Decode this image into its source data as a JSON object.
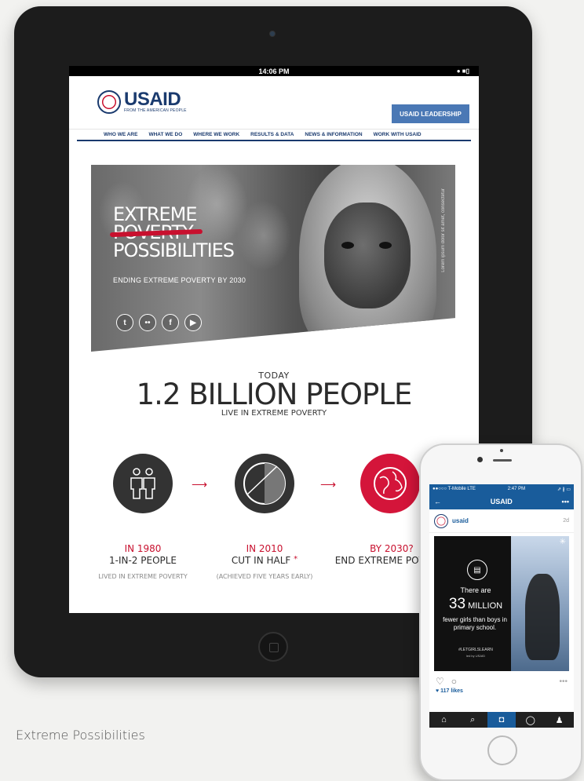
{
  "tablet": {
    "status_time": "14:06 PM",
    "status_right": "● ■▯"
  },
  "site": {
    "logo_word": "USAID",
    "logo_tagline": "FROM THE AMERICAN PEOPLE",
    "leadership_button": "USAID LEADERSHIP",
    "nav": [
      "WHO WE ARE",
      "WHAT WE DO",
      "WHERE WE WORK",
      "RESULTS & DATA",
      "NEWS & INFORMATION",
      "WORK WITH USAID"
    ]
  },
  "hero": {
    "title_line1": "EXTREME",
    "title_line2": "POVERTY",
    "title_line3": "POSSIBILITIES",
    "subtitle": "ENDING EXTREME POVERTY BY 2030",
    "photo_caption": "Lorem ipsum dolor sit amet, consectetur",
    "socials": [
      "twitter-icon",
      "flickr-icon",
      "facebook-icon",
      "youtube-icon"
    ],
    "social_glyphs": [
      "t",
      "••",
      "f",
      "▶"
    ]
  },
  "stats": {
    "today": "TODAY",
    "big": "1.2 BILLION PEOPLE",
    "under": "LIVE IN EXTREME POVERTY",
    "arrow": "⟶",
    "columns": [
      {
        "year": "IN 1980",
        "main": "1-IN-2 PEOPLE",
        "note": "LIVED IN EXTREME POVERTY"
      },
      {
        "year": "IN 2010",
        "main": "CUT IN HALF",
        "asterisk": "*",
        "note": "(ACHIEVED FIVE YEARS EARLY)"
      },
      {
        "year": "BY 2030?",
        "main": "END EXTREME POVERTY",
        "note": ""
      }
    ]
  },
  "caption": "Extreme Possibilities",
  "phone": {
    "carrier": "●●○○○ T-Mobile  LTE",
    "time": "2:47 PM",
    "battery": "⇗ ∦ ▭",
    "back": "←",
    "title": "USAID",
    "menu": "•••",
    "username": "usaid",
    "age": "2d",
    "post_line1": "There are",
    "post_number": "33",
    "post_million": "MILLION",
    "post_line3": "fewer girls than boys in primary school.",
    "post_hashtag": "#LETGIRLSLEARN",
    "post_led": "led by USAID",
    "post_corner": "✳",
    "book_glyph": "📖",
    "action_like": "♡",
    "action_comment": "○",
    "action_more": "•••",
    "likes": "♥ 117 likes",
    "tabs": [
      "⌂",
      "⌕",
      "◘",
      "◯",
      "♟"
    ]
  }
}
